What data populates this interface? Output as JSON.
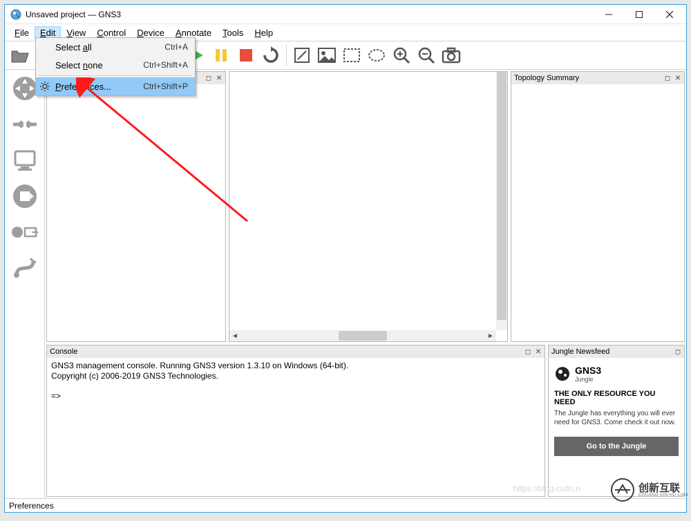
{
  "window": {
    "title": "Unsaved project — GNS3"
  },
  "menubar": {
    "items": [
      {
        "label": "File",
        "mnemonic": "F"
      },
      {
        "label": "Edit",
        "mnemonic": "E",
        "open": true
      },
      {
        "label": "View",
        "mnemonic": "V"
      },
      {
        "label": "Control",
        "mnemonic": "C"
      },
      {
        "label": "Device",
        "mnemonic": "D"
      },
      {
        "label": "Annotate",
        "mnemonic": "A"
      },
      {
        "label": "Tools",
        "mnemonic": "T"
      },
      {
        "label": "Help",
        "mnemonic": "H"
      }
    ]
  },
  "edit_menu": {
    "select_all": {
      "label": "Select all",
      "shortcut": "Ctrl+A",
      "mnemonic": "a"
    },
    "select_none": {
      "label": "Select none",
      "shortcut": "Ctrl+Shift+A",
      "mnemonic": "n"
    },
    "preferences": {
      "label": "Preferences...",
      "shortcut": "Ctrl+Shift+P",
      "mnemonic": "P"
    }
  },
  "panels": {
    "topology": {
      "title": "Topology Summary"
    },
    "console": {
      "title": "Console"
    },
    "newsfeed": {
      "title": "Jungle Newsfeed"
    }
  },
  "console": {
    "line1": "GNS3 management console. Running GNS3 version 1.3.10 on Windows (64-bit).",
    "line2": "Copyright (c) 2006-2019 GNS3 Technologies.",
    "line3": "",
    "prompt": "=>"
  },
  "newsfeed": {
    "brand": "GNS3",
    "brand_sub": "Jungle",
    "headline": "THE ONLY RESOURCE YOU NEED",
    "body": "The Jungle has everything you will ever need for GNS3. Come check it out now.",
    "cta": "Go to the Jungle"
  },
  "statusbar": {
    "text": "Preferences"
  },
  "watermark": {
    "text": "创新互联",
    "sub": "CHUANG XIN HU LIAN"
  },
  "faint_url": "https://blog.csdn.n"
}
